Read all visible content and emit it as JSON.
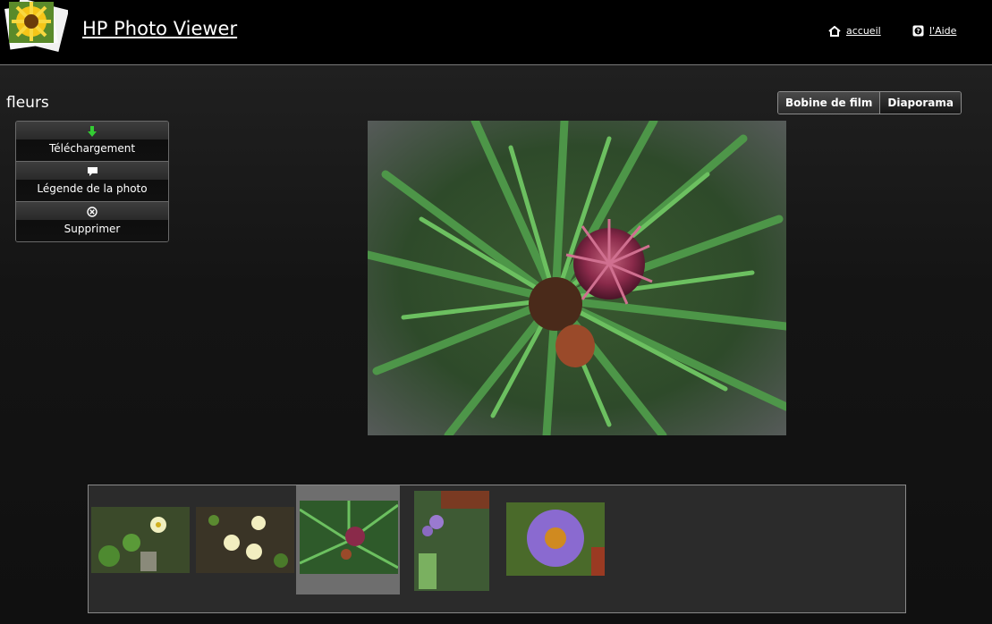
{
  "header": {
    "app_title": "HP Photo Viewer",
    "links": [
      {
        "label": "accueil",
        "icon": "home-icon"
      },
      {
        "label": "l'Aide",
        "icon": "help-icon"
      }
    ]
  },
  "album": {
    "title": "fleurs"
  },
  "view_toggle": {
    "options": [
      "Bobine de film",
      "Diaporama"
    ],
    "active": "Bobine de film"
  },
  "actions": [
    {
      "label": "Téléchargement",
      "icon": "download-arrow-icon",
      "icon_color": "#33cc33"
    },
    {
      "label": "Légende de la photo",
      "icon": "caption-bubble-icon"
    },
    {
      "label": "Supprimer",
      "icon": "delete-circle-x-icon"
    }
  ],
  "photo": {
    "subject": "pine branch with purple cone"
  },
  "filmstrip": {
    "thumbnails": [
      {
        "subject": "white flowers with green leaves"
      },
      {
        "subject": "white flowers in grass"
      },
      {
        "subject": "pine branch with purple cone",
        "selected": true
      },
      {
        "subject": "small purple flowers"
      },
      {
        "subject": "purple aster flower"
      }
    ]
  }
}
